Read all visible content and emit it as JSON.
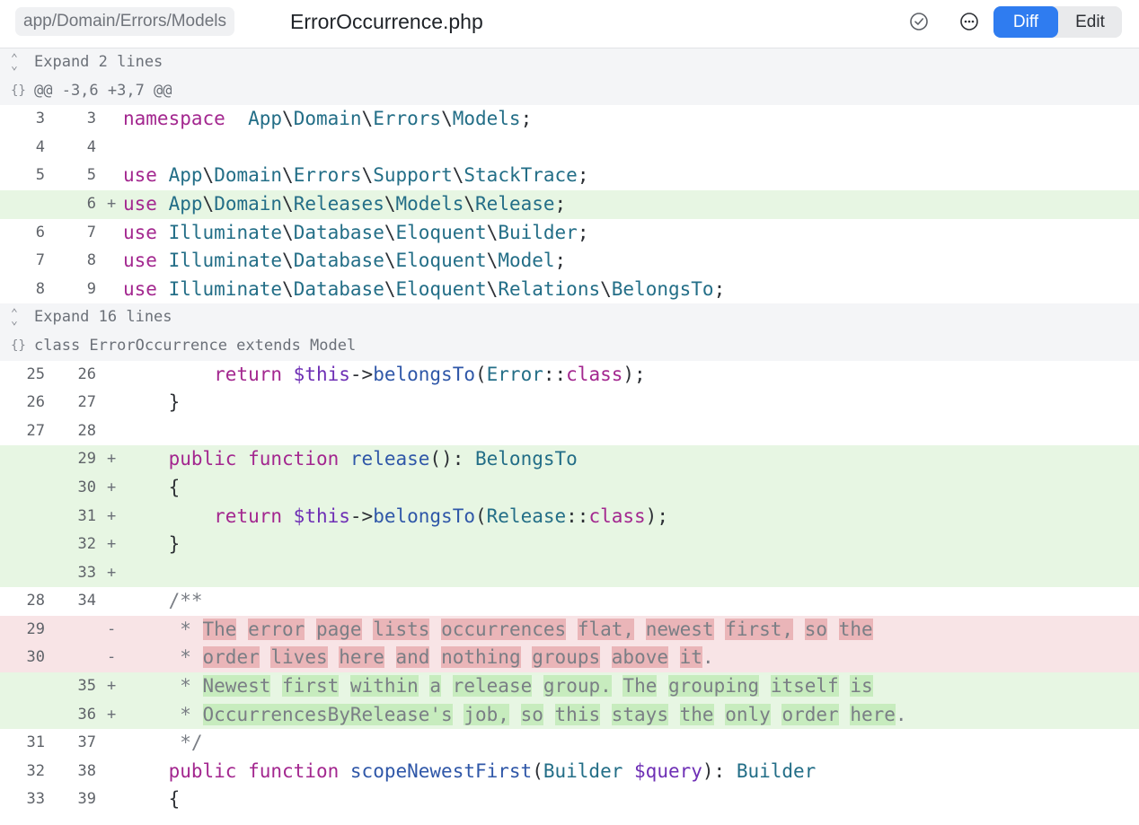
{
  "header": {
    "breadcrumb": "app/Domain/Errors/Models",
    "file_name": "ErrorOccurrence.php",
    "tabs": {
      "diff": "Diff",
      "edit": "Edit"
    },
    "icons": [
      "checkmark-circle-icon",
      "more-options-icon"
    ]
  },
  "colors": {
    "accent": "#2f7cf0",
    "added_bg": "#e7f6e3",
    "removed_bg": "#f8e4e6"
  },
  "diff_rows": [
    {
      "type": "expand",
      "glyph": "⌃⌄",
      "text": "Expand 2 lines"
    },
    {
      "type": "hunk",
      "glyph": "{}",
      "text": "@@ -3,6 +3,7 @@"
    },
    {
      "type": "ctx",
      "old": "3",
      "new": "3",
      "sign": "",
      "tokens": [
        [
          "kw",
          "namespace"
        ],
        [
          "",
          "  "
        ],
        [
          "ns",
          "App"
        ],
        [
          "",
          "\\"
        ],
        [
          "ns",
          "Domain"
        ],
        [
          "",
          "\\"
        ],
        [
          "ns",
          "Errors"
        ],
        [
          "",
          "\\"
        ],
        [
          "ns",
          "Models"
        ],
        [
          "",
          ";"
        ]
      ]
    },
    {
      "type": "ctx",
      "old": "4",
      "new": "4",
      "sign": "",
      "tokens": []
    },
    {
      "type": "ctx",
      "old": "5",
      "new": "5",
      "sign": "",
      "tokens": [
        [
          "kw",
          "use"
        ],
        [
          "",
          " "
        ],
        [
          "ns",
          "App"
        ],
        [
          "",
          "\\"
        ],
        [
          "ns",
          "Domain"
        ],
        [
          "",
          "\\"
        ],
        [
          "ns",
          "Errors"
        ],
        [
          "",
          "\\"
        ],
        [
          "ns",
          "Support"
        ],
        [
          "",
          "\\"
        ],
        [
          "ns",
          "StackTrace"
        ],
        [
          "",
          ";"
        ]
      ]
    },
    {
      "type": "add",
      "old": "",
      "new": "6",
      "sign": "+",
      "tokens": [
        [
          "kw",
          "use"
        ],
        [
          "",
          " "
        ],
        [
          "ns",
          "App"
        ],
        [
          "",
          "\\"
        ],
        [
          "ns",
          "Domain"
        ],
        [
          "",
          "\\"
        ],
        [
          "ns",
          "Releases"
        ],
        [
          "",
          "\\"
        ],
        [
          "ns",
          "Models"
        ],
        [
          "",
          "\\"
        ],
        [
          "ns",
          "Release"
        ],
        [
          "",
          ";"
        ]
      ]
    },
    {
      "type": "ctx",
      "old": "6",
      "new": "7",
      "sign": "",
      "tokens": [
        [
          "kw",
          "use"
        ],
        [
          "",
          " "
        ],
        [
          "ns",
          "Illuminate"
        ],
        [
          "",
          "\\"
        ],
        [
          "ns",
          "Database"
        ],
        [
          "",
          "\\"
        ],
        [
          "ns",
          "Eloquent"
        ],
        [
          "",
          "\\"
        ],
        [
          "ns",
          "Builder"
        ],
        [
          "",
          ";"
        ]
      ]
    },
    {
      "type": "ctx",
      "old": "7",
      "new": "8",
      "sign": "",
      "tokens": [
        [
          "kw",
          "use"
        ],
        [
          "",
          " "
        ],
        [
          "ns",
          "Illuminate"
        ],
        [
          "",
          "\\"
        ],
        [
          "ns",
          "Database"
        ],
        [
          "",
          "\\"
        ],
        [
          "ns",
          "Eloquent"
        ],
        [
          "",
          "\\"
        ],
        [
          "ns",
          "Model"
        ],
        [
          "",
          ";"
        ]
      ]
    },
    {
      "type": "ctx",
      "old": "8",
      "new": "9",
      "sign": "",
      "tokens": [
        [
          "kw",
          "use"
        ],
        [
          "",
          " "
        ],
        [
          "ns",
          "Illuminate"
        ],
        [
          "",
          "\\"
        ],
        [
          "ns",
          "Database"
        ],
        [
          "",
          "\\"
        ],
        [
          "ns",
          "Eloquent"
        ],
        [
          "",
          "\\"
        ],
        [
          "ns",
          "Relations"
        ],
        [
          "",
          "\\"
        ],
        [
          "ns",
          "BelongsTo"
        ],
        [
          "",
          ";"
        ]
      ]
    },
    {
      "type": "expand",
      "glyph": "⌃⌄",
      "text": "Expand 16 lines"
    },
    {
      "type": "hunk",
      "glyph": "{}",
      "text": "class ErrorOccurrence extends Model"
    },
    {
      "type": "ctx",
      "old": "25",
      "new": "26",
      "sign": "",
      "tokens": [
        [
          "",
          "        "
        ],
        [
          "kw",
          "return"
        ],
        [
          "",
          " "
        ],
        [
          "var",
          "$this"
        ],
        [
          "",
          "->"
        ],
        [
          "fn",
          "belongsTo"
        ],
        [
          "",
          "("
        ],
        [
          "ns",
          "Error"
        ],
        [
          "",
          "::"
        ],
        [
          "kw",
          "class"
        ],
        [
          "",
          ");"
        ]
      ]
    },
    {
      "type": "ctx",
      "old": "26",
      "new": "27",
      "sign": "",
      "tokens": [
        [
          "",
          "    }"
        ]
      ]
    },
    {
      "type": "ctx",
      "old": "27",
      "new": "28",
      "sign": "",
      "tokens": []
    },
    {
      "type": "add",
      "old": "",
      "new": "29",
      "sign": "+",
      "tokens": [
        [
          "",
          "    "
        ],
        [
          "kw",
          "public"
        ],
        [
          "",
          " "
        ],
        [
          "kw",
          "function"
        ],
        [
          "",
          " "
        ],
        [
          "fn",
          "release"
        ],
        [
          "",
          "(): "
        ],
        [
          "ns",
          "BelongsTo"
        ]
      ]
    },
    {
      "type": "add",
      "old": "",
      "new": "30",
      "sign": "+",
      "tokens": [
        [
          "",
          "    {"
        ]
      ]
    },
    {
      "type": "add",
      "old": "",
      "new": "31",
      "sign": "+",
      "tokens": [
        [
          "",
          "        "
        ],
        [
          "kw",
          "return"
        ],
        [
          "",
          " "
        ],
        [
          "var",
          "$this"
        ],
        [
          "",
          "->"
        ],
        [
          "fn",
          "belongsTo"
        ],
        [
          "",
          "("
        ],
        [
          "ns",
          "Release"
        ],
        [
          "",
          "::"
        ],
        [
          "kw",
          "class"
        ],
        [
          "",
          ");"
        ]
      ]
    },
    {
      "type": "add",
      "old": "",
      "new": "32",
      "sign": "+",
      "tokens": [
        [
          "",
          "    }"
        ]
      ]
    },
    {
      "type": "add",
      "old": "",
      "new": "33",
      "sign": "+",
      "tokens": []
    },
    {
      "type": "ctx",
      "old": "28",
      "new": "34",
      "sign": "",
      "tokens": [
        [
          "cm",
          "    /**"
        ]
      ]
    },
    {
      "type": "del",
      "old": "29",
      "new": "",
      "sign": "-",
      "tokens": [
        [
          "cm",
          "     * "
        ],
        [
          "cm hl-del",
          "The"
        ],
        [
          "cm",
          " "
        ],
        [
          "cm hl-del",
          "error"
        ],
        [
          "cm",
          " "
        ],
        [
          "cm hl-del",
          "page"
        ],
        [
          "cm",
          " "
        ],
        [
          "cm hl-del",
          "lists"
        ],
        [
          "cm",
          " "
        ],
        [
          "cm hl-del",
          "occurrences"
        ],
        [
          "cm",
          " "
        ],
        [
          "cm hl-del",
          "flat,"
        ],
        [
          "cm",
          " "
        ],
        [
          "cm hl-del",
          "newest"
        ],
        [
          "cm",
          " "
        ],
        [
          "cm hl-del",
          "first,"
        ],
        [
          "cm",
          " "
        ],
        [
          "cm hl-del",
          "so"
        ],
        [
          "cm",
          " "
        ],
        [
          "cm hl-del",
          "the"
        ]
      ]
    },
    {
      "type": "del",
      "old": "30",
      "new": "",
      "sign": "-",
      "tokens": [
        [
          "cm",
          "     * "
        ],
        [
          "cm hl-del",
          "order"
        ],
        [
          "cm",
          " "
        ],
        [
          "cm hl-del",
          "lives"
        ],
        [
          "cm",
          " "
        ],
        [
          "cm hl-del",
          "here"
        ],
        [
          "cm",
          " "
        ],
        [
          "cm hl-del",
          "and"
        ],
        [
          "cm",
          " "
        ],
        [
          "cm hl-del",
          "nothing"
        ],
        [
          "cm",
          " "
        ],
        [
          "cm hl-del",
          "groups"
        ],
        [
          "cm",
          " "
        ],
        [
          "cm hl-del",
          "above"
        ],
        [
          "cm",
          " "
        ],
        [
          "cm hl-del",
          "it"
        ],
        [
          "cm",
          "."
        ]
      ]
    },
    {
      "type": "add",
      "old": "",
      "new": "35",
      "sign": "+",
      "tokens": [
        [
          "cm",
          "     * "
        ],
        [
          "cm hl-add",
          "Newest"
        ],
        [
          "cm",
          " "
        ],
        [
          "cm hl-add",
          "first"
        ],
        [
          "cm",
          " "
        ],
        [
          "cm hl-add",
          "within"
        ],
        [
          "cm",
          " "
        ],
        [
          "cm hl-add",
          "a"
        ],
        [
          "cm",
          " "
        ],
        [
          "cm hl-add",
          "release"
        ],
        [
          "cm",
          " "
        ],
        [
          "cm hl-add",
          "group."
        ],
        [
          "cm",
          " "
        ],
        [
          "cm hl-add",
          "The"
        ],
        [
          "cm",
          " "
        ],
        [
          "cm hl-add",
          "grouping"
        ],
        [
          "cm",
          " "
        ],
        [
          "cm hl-add",
          "itself"
        ],
        [
          "cm",
          " "
        ],
        [
          "cm hl-add",
          "is"
        ]
      ]
    },
    {
      "type": "add",
      "old": "",
      "new": "36",
      "sign": "+",
      "tokens": [
        [
          "cm",
          "     * "
        ],
        [
          "cm hl-add",
          "OccurrencesByRelease's"
        ],
        [
          "cm",
          " "
        ],
        [
          "cm hl-add",
          "job,"
        ],
        [
          "cm",
          " "
        ],
        [
          "cm hl-add",
          "so"
        ],
        [
          "cm",
          " "
        ],
        [
          "cm hl-add",
          "this"
        ],
        [
          "cm",
          " "
        ],
        [
          "cm hl-add",
          "stays"
        ],
        [
          "cm",
          " "
        ],
        [
          "cm hl-add",
          "the"
        ],
        [
          "cm",
          " "
        ],
        [
          "cm hl-add",
          "only"
        ],
        [
          "cm",
          " "
        ],
        [
          "cm hl-add",
          "order"
        ],
        [
          "cm",
          " "
        ],
        [
          "cm hl-add",
          "here"
        ],
        [
          "cm",
          "."
        ]
      ]
    },
    {
      "type": "ctx",
      "old": "31",
      "new": "37",
      "sign": "",
      "tokens": [
        [
          "cm",
          "     */"
        ]
      ]
    },
    {
      "type": "ctx",
      "old": "32",
      "new": "38",
      "sign": "",
      "tokens": [
        [
          "",
          "    "
        ],
        [
          "kw",
          "public"
        ],
        [
          "",
          " "
        ],
        [
          "kw",
          "function"
        ],
        [
          "",
          " "
        ],
        [
          "fn",
          "scopeNewestFirst"
        ],
        [
          "",
          "("
        ],
        [
          "ns",
          "Builder"
        ],
        [
          "",
          " "
        ],
        [
          "var",
          "$query"
        ],
        [
          "",
          "): "
        ],
        [
          "ns",
          "Builder"
        ]
      ]
    },
    {
      "type": "ctx",
      "old": "33",
      "new": "39",
      "sign": "",
      "tokens": [
        [
          "",
          "    {"
        ]
      ]
    }
  ]
}
